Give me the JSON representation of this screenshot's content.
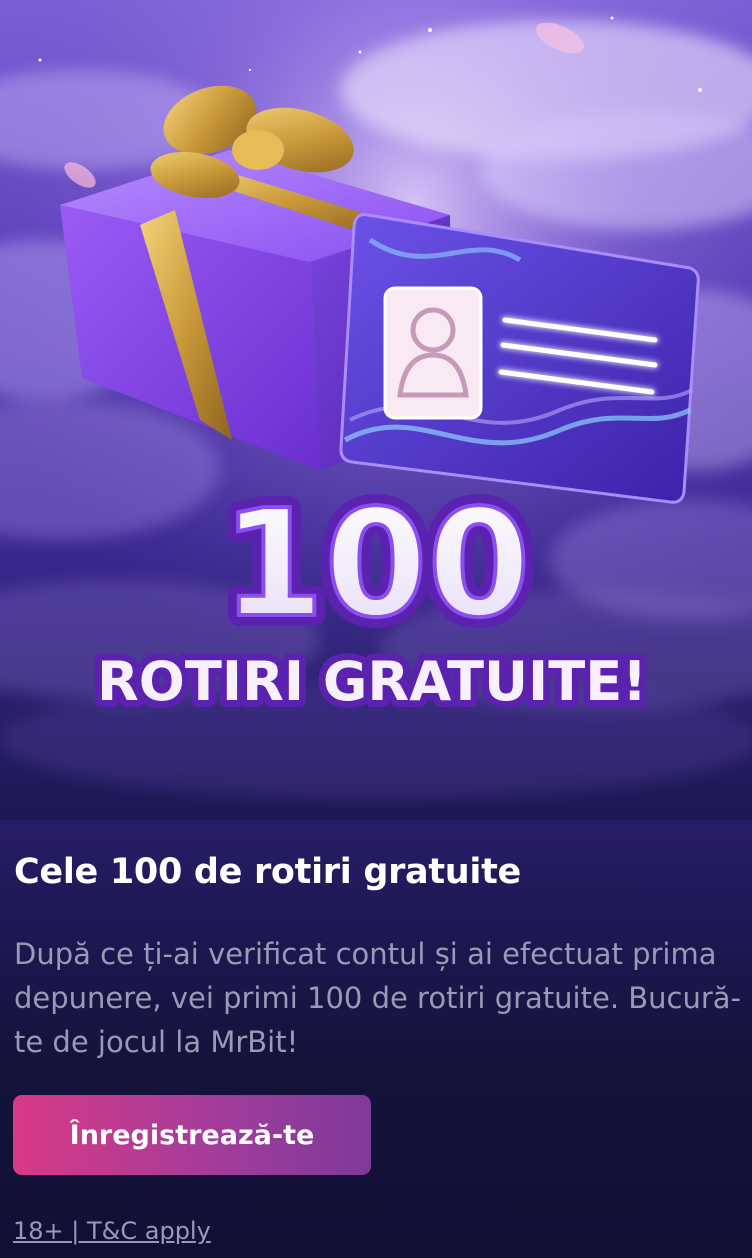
{
  "hero": {
    "headline_number": "100",
    "headline_text": "ROTIRI GRATUITE!"
  },
  "promo": {
    "title": "Cele 100 de rotiri gratuite",
    "description": "După ce ți-ai verificat contul și ai efectuat prima depunere, vei primi 100 de rotiri gratuite. Bucură-te de jocul la MrBit!",
    "cta_label": "Înregistrează-te",
    "legal": "18+ | T&C apply"
  },
  "colors": {
    "cta_start": "#d83a86",
    "cta_end": "#7d3a9a",
    "background_dark": "#120f34"
  }
}
